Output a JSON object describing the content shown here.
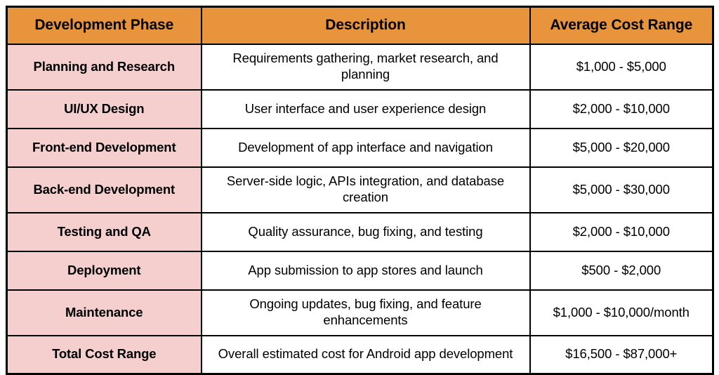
{
  "table": {
    "accent_header_color": "#e8943c",
    "phase_column_color": "#f5cece",
    "cell_background_color": "#ffffff",
    "border_color": "#000000",
    "text_color": "#000000",
    "columns": [
      {
        "key": "phase",
        "header": "Development Phase"
      },
      {
        "key": "description",
        "header": "Description"
      },
      {
        "key": "cost",
        "header": "Average Cost Range"
      }
    ],
    "rows": [
      {
        "phase": "Planning and Research",
        "description": "Requirements gathering, market research, and planning",
        "cost": "$1,000 - $5,000",
        "lines": 2
      },
      {
        "phase": "UI/UX Design",
        "description": "User interface and user experience design",
        "cost": "$2,000 - $10,000",
        "lines": 1
      },
      {
        "phase": "Front-end Development",
        "description": "Development of app interface and navigation",
        "cost": "$5,000 - $20,000",
        "lines": 1
      },
      {
        "phase": "Back-end Development",
        "description": "Server-side logic, APIs integration, and database creation",
        "cost": "$5,000 - $30,000",
        "lines": 2
      },
      {
        "phase": "Testing and QA",
        "description": "Quality assurance, bug fixing, and testing",
        "cost": "$2,000 - $10,000",
        "lines": 1
      },
      {
        "phase": "Deployment",
        "description": "App submission to app stores and launch",
        "cost": "$500 - $2,000",
        "lines": 1
      },
      {
        "phase": "Maintenance",
        "description": "Ongoing updates, bug fixing, and feature enhancements",
        "cost": "$1,000 - $10,000/month",
        "lines": 2
      },
      {
        "phase": "Total Cost Range",
        "description": "Overall estimated cost for Android app development",
        "cost": "$16,500 - $87,000+",
        "lines": 1
      }
    ]
  }
}
